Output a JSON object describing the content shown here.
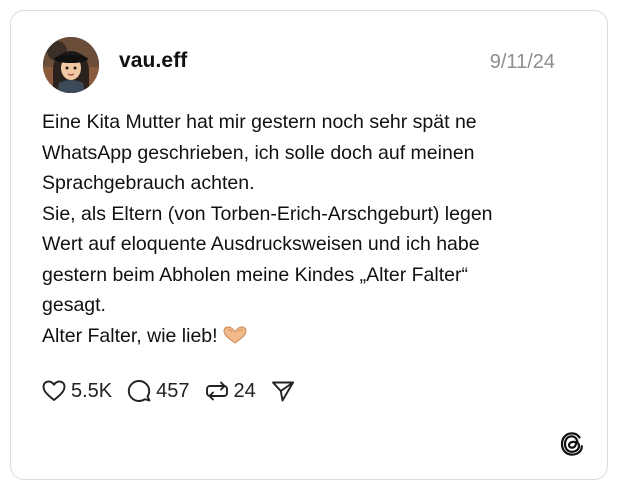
{
  "post": {
    "username": "vau.eff",
    "date": "9/11/24",
    "lines": [
      "Eine Kita Mutter hat mir gestern noch sehr spät ne",
      "WhatsApp geschrieben, ich solle doch auf meinen",
      "Sprachgebrauch achten.",
      "Sie, als Eltern (von Torben-Erich-Arschgeburt) legen",
      "Wert auf eloquente Ausdrucksweisen und ich habe",
      "gestern beim Abholen meine Kindes „Alter Falter“",
      "gesagt.",
      "Alter Falter, wie lieb!"
    ],
    "emoji": "heart-hands"
  },
  "actions": {
    "likes": "5.5K",
    "replies": "457",
    "reposts": "24",
    "like_icon": "heart-icon",
    "reply_icon": "comment-icon",
    "repost_icon": "repost-icon",
    "share_icon": "send-icon"
  },
  "brand": {
    "logo": "threads-logo-icon"
  },
  "colors": {
    "text": "#101010",
    "muted": "#8e8e8e",
    "border": "#dcdcdc",
    "emoji": "#f2b98a"
  }
}
